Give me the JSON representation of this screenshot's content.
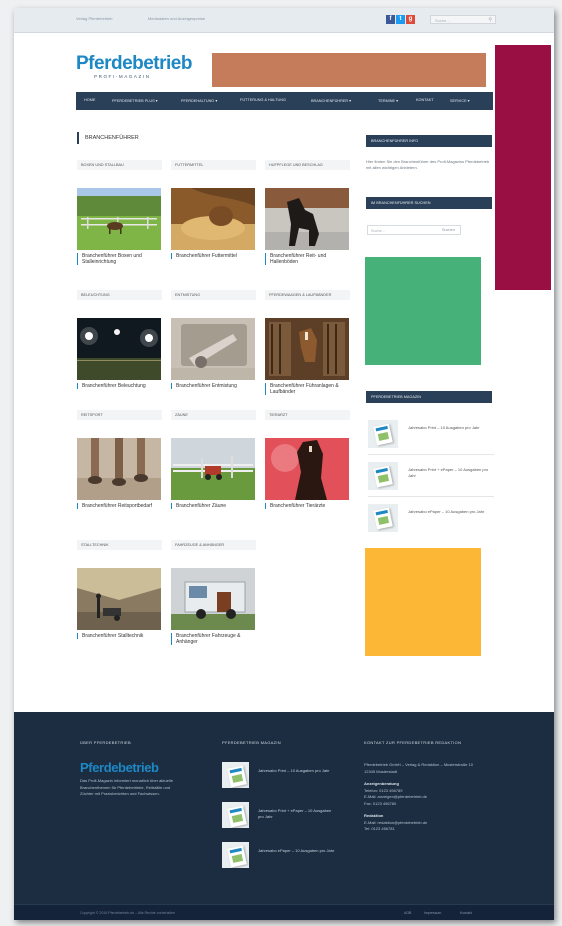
{
  "topbar": {
    "link1": "Verlag Pferdebetrieb",
    "link2": "Mediadaten und Anzeigenpreise",
    "search_placeholder": "Suche...",
    "social": [
      {
        "label": "f",
        "color": "#3b5998"
      },
      {
        "label": "t",
        "color": "#1d9bf0"
      },
      {
        "label": "g",
        "color": "#dd4b39"
      }
    ]
  },
  "logo": {
    "word": "Pferdebetrieb",
    "sub": "PROFI-MAGAZIN"
  },
  "nav": {
    "items": [
      "Home",
      "Pferdebetrieb Plus ▾",
      "Pferdehaltung ▾",
      "Fütterung & Haltung",
      "Branchenführer ▾",
      "Termine ▾",
      "Kontakt",
      "Service ▾"
    ]
  },
  "page_title": "Branchenführer",
  "categories": [
    {
      "tab": "Boxen und Stallbau",
      "caption": "Branchenführer Boxen und Stalleinrichtung"
    },
    {
      "tab": "Futtermittel",
      "caption": "Branchenführer Futtermittel"
    },
    {
      "tab": "Hufpflege und Beschlag",
      "caption": "Branchenführer Reit- und Hallenböden"
    },
    {
      "tab": "Beleuchtung",
      "caption": "Branchenführer Beleuchtung"
    },
    {
      "tab": "Entmistung",
      "caption": "Branchenführer Entmistung"
    },
    {
      "tab": "Pferdewaagen & Laufbänder",
      "caption": "Branchenführer Führanlagen & Laufbänder"
    },
    {
      "tab": "Reitsport",
      "caption": "Branchenführer Reitsportbedarf"
    },
    {
      "tab": "Zäune",
      "caption": "Branchenführer Zäune"
    },
    {
      "tab": "Tierarzt",
      "caption": "Branchenführer Tierärzte"
    },
    {
      "tab": "Stalltechnik",
      "caption": "Branchenführer Stalltechnik"
    },
    {
      "tab": "Fahrzeuge & Anhänger",
      "caption": "Branchenführer Fahrzeuge & Anhänger"
    }
  ],
  "sidebar": {
    "head1": "Branchenführer Info",
    "text": "Hier finden Sie den Branchenführer des Profi-Magazins Pferdebetrieb mit allen wichtigen Anbietern.",
    "head2": "Im Branchenführer suchen",
    "search_placeholder": "Suche...",
    "search_button": "Suchen",
    "head3": "Pferdebetrieb Magazin",
    "mags": [
      {
        "title": "Jahresabo Print – 10 Ausgaben pro Jahr"
      },
      {
        "title": "Jahresabo Print + ePaper – 10 Ausgaben pro Jahr"
      },
      {
        "title": "Jahresabo ePaper – 10 Ausgaben pro Jahr"
      }
    ]
  },
  "footer": {
    "col1_head": "Über Pferdebetrieb",
    "col1_logo": "Pferdebetrieb",
    "col1_text": "Das Profi-Magazin informiert monatlich über aktuelle Branchenthemen für Pferdebetriebe, Reitställe und Züchter mit Praxisberichten und Fachwissen.",
    "col2_head": "Pferdebetrieb Magazin",
    "col2_mags": [
      {
        "title": "Jahresabo Print – 10 Ausgaben pro Jahr"
      },
      {
        "title": "Jahresabo Print + ePaper – 10 Ausgaben pro Jahr"
      },
      {
        "title": "Jahresabo ePaper – 10 Ausgaben pro Jahr"
      }
    ],
    "col3_head": "Kontakt zur Pferdebetrieb Redaktion",
    "col3_lines": [
      "Pferdebetrieb GmbH – Verlag & Redaktion – Musterstraße 10",
      "12345 Musterstadt",
      "",
      "Anzeigenberatung",
      "Telefon: 0123 456789",
      "E-Mail: anzeigen@pferdebetrieb.de",
      "Fax: 0123 456780",
      "",
      "Redaktion",
      "E-Mail: redaktion@pferdebetrieb.de",
      "Tel: 0123 456781"
    ],
    "copyright": "Copyright © 2016 Pferdebetrieb.de – Alle Rechte vorbehalten",
    "links": [
      "AGB",
      "Impressum",
      "Kontakt"
    ]
  }
}
